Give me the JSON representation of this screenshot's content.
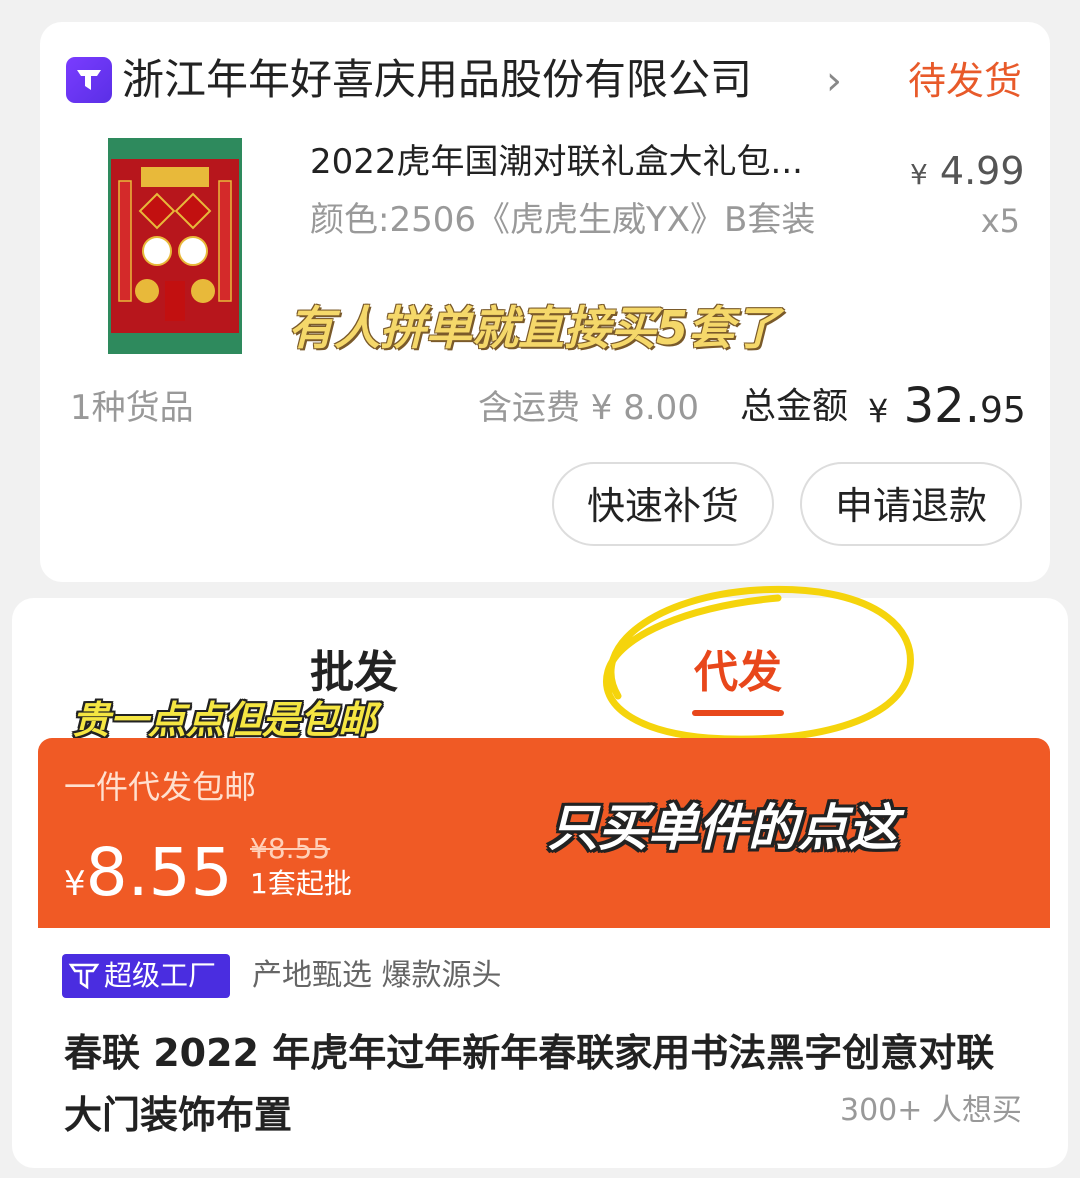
{
  "order": {
    "shop_name": "浙江年年好喜庆用品股份有限公司",
    "chevron": "›",
    "status": "待发货",
    "product": {
      "title": "2022虎年国潮对联礼盒大礼包...",
      "variant": "颜色:2506《虎虎生威YX》B套装",
      "price_currency": "¥",
      "price_value": "4.99",
      "quantity": "x5"
    },
    "annotation": "有人拼单就直接买5套了",
    "goods_count": "1种货品",
    "shipping": "含运费 ¥ 8.00",
    "total_label": "总金额",
    "total_currency": "¥",
    "total_int": "32.",
    "total_dec": "95",
    "buttons": {
      "restock": "快速补货",
      "refund": "申请退款"
    }
  },
  "tabs": {
    "wholesale": "批发",
    "dropship": "代发"
  },
  "annotations": {
    "pricier": "贵一点点但是包邮",
    "single_purchase": "只买单件的点这"
  },
  "dropship": {
    "title": "一件代发包邮",
    "currency": "¥",
    "price": "8.55",
    "old_price": "¥8.55",
    "min_order": "1套起批"
  },
  "listing": {
    "badge": "超级工厂",
    "tags": "产地甄选 爆款源头",
    "title": "春联 2022 年虎年过年新年春联家用书法黑字创意对联大门装饰布置",
    "want_count": "300+ 人想买"
  },
  "colors": {
    "accent_orange": "#f05a25",
    "status_orange": "#e85a2a",
    "brand_purple": "#5a2fe6",
    "annotation_yellow": "#f5e642"
  }
}
